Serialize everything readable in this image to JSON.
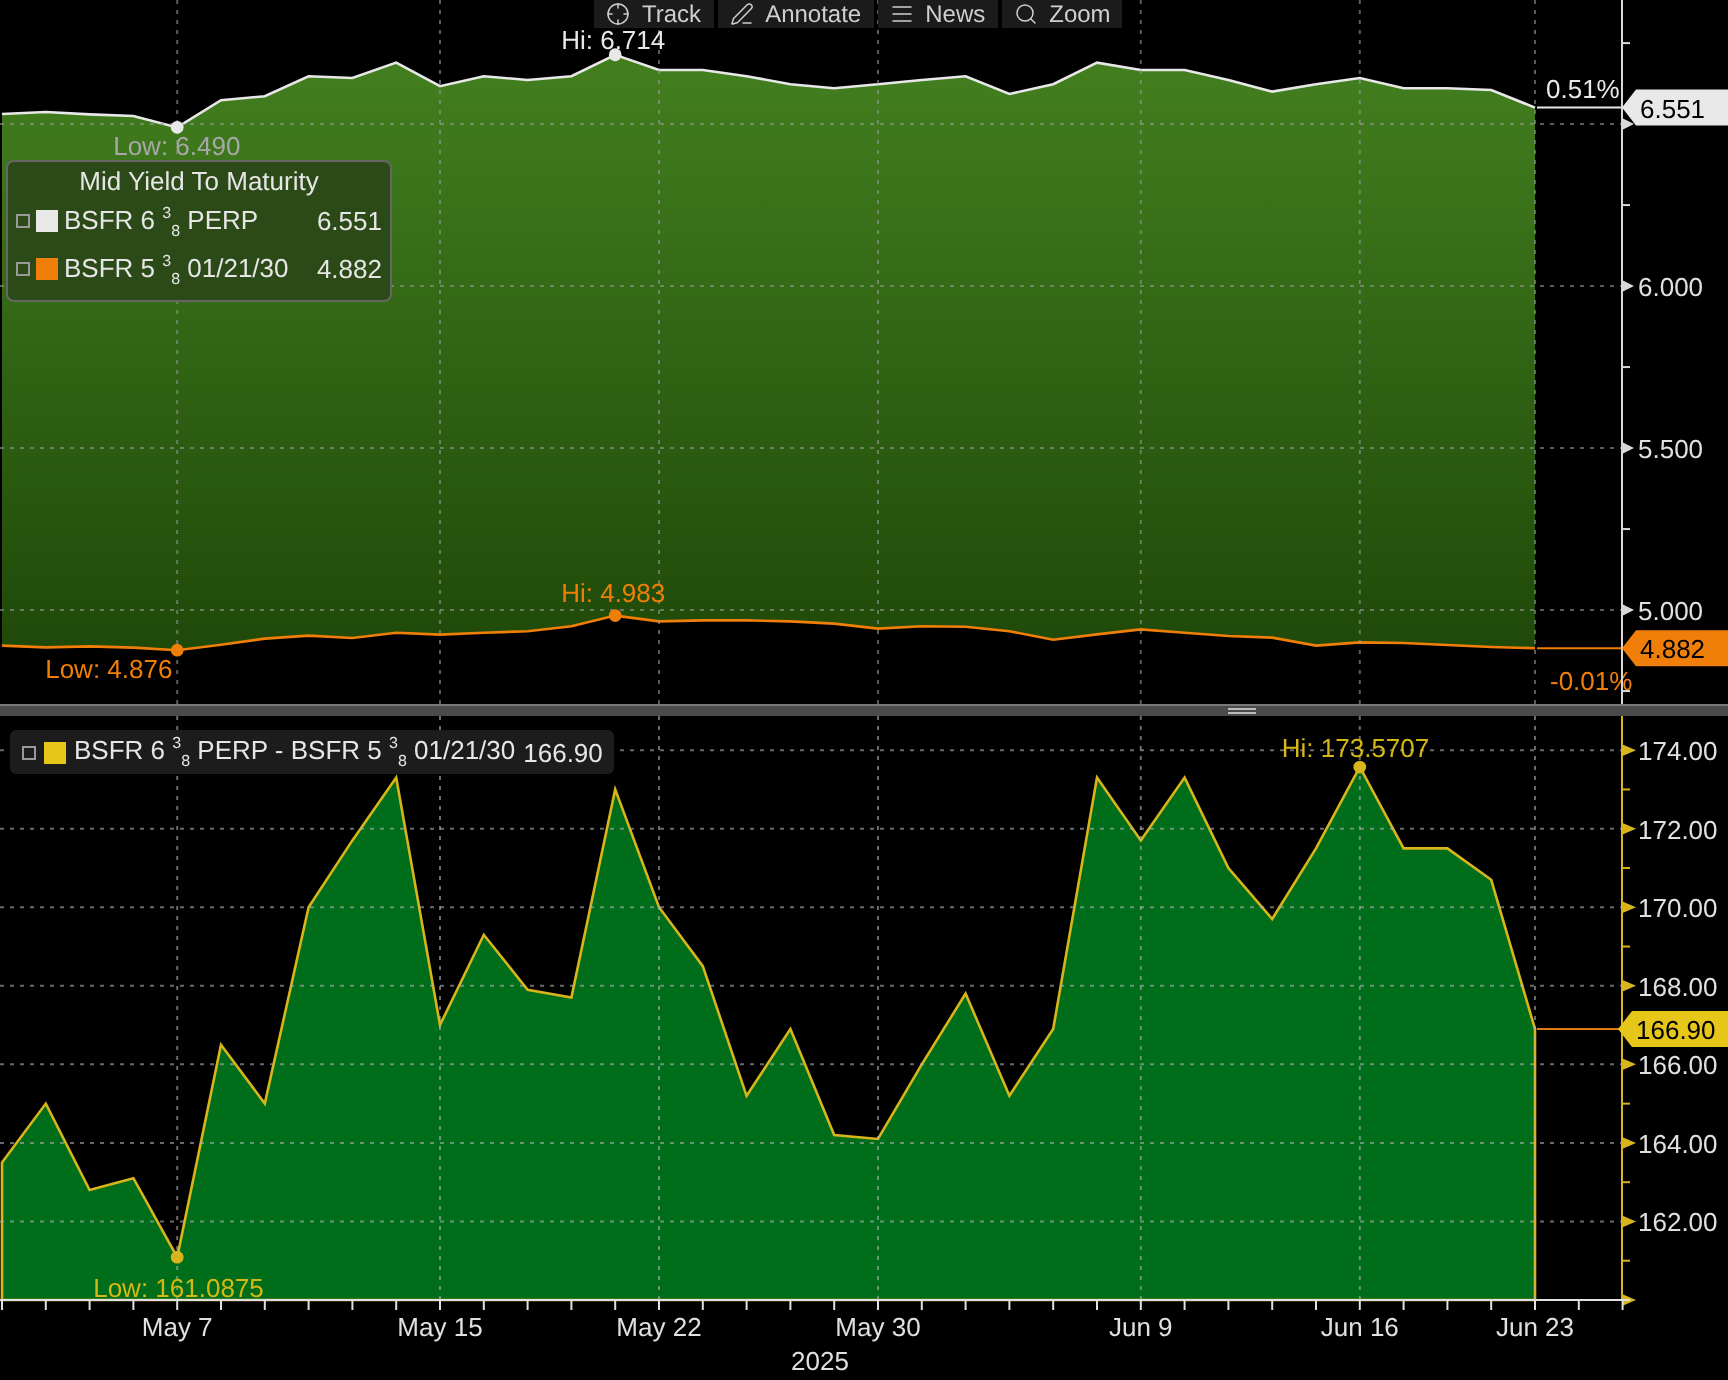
{
  "toolbar": [
    {
      "label": "Track"
    },
    {
      "label": "Annotate"
    },
    {
      "label": "News"
    },
    {
      "label": "Zoom"
    }
  ],
  "top": {
    "legend": {
      "title": "Mid Yield To Maturity",
      "rows": [
        {
          "name": "BSFR 6 $^{3}$$_{8}$ PERP",
          "value": "6.551"
        },
        {
          "name": "BSFR 5 $^{3}$$_{8}$ 01/21/30",
          "value": "4.882"
        }
      ]
    },
    "chart_data": {
      "type": "line",
      "grid": true,
      "series": [
        {
          "color": "#e8e8e8",
          "values": [
            6.531,
            6.537,
            6.53,
            6.525,
            6.49,
            6.574,
            6.586,
            6.648,
            6.642,
            6.69,
            6.617,
            6.648,
            6.636,
            6.648,
            6.714,
            6.667,
            6.667,
            6.648,
            6.623,
            6.611,
            6.623,
            6.636,
            6.648,
            6.593,
            6.623,
            6.69,
            6.667,
            6.667,
            6.636,
            6.6,
            6.623,
            6.642,
            6.611,
            6.611,
            6.605,
            6.551
          ]
        },
        {
          "color": "#f07f09",
          "values": [
            4.89,
            4.885,
            4.888,
            4.884,
            4.876,
            4.893,
            4.912,
            4.921,
            4.914,
            4.93,
            4.924,
            4.93,
            4.935,
            4.95,
            4.983,
            4.965,
            4.968,
            4.968,
            4.965,
            4.958,
            4.943,
            4.95,
            4.948,
            4.935,
            4.908,
            4.925,
            4.94,
            4.93,
            4.92,
            4.915,
            4.89,
            4.9,
            4.898,
            4.892,
            4.886,
            4.882
          ]
        }
      ],
      "ylim": [
        4.71,
        6.883
      ],
      "yticks": [
        {
          "value": 6.0,
          "label": "6.000"
        },
        {
          "value": 5.5,
          "label": "5.500"
        },
        {
          "value": 5.0,
          "label": "5.000"
        }
      ],
      "annotations": [
        {
          "text": "Hi: 6.714",
          "y": 6.714
        },
        {
          "text": "Low: 6.490",
          "y": 6.49
        },
        {
          "text": "Hi: 4.983",
          "y": 4.983
        },
        {
          "text": "Low: 4.876",
          "y": 4.876
        }
      ]
    },
    "changes": [
      {
        "text": "0.51%"
      },
      {
        "text": "-0.01%"
      }
    ],
    "tags": [
      {
        "text": "6.551"
      },
      {
        "text": "4.882"
      }
    ]
  },
  "bottom": {
    "legend": {
      "name": "BSFR 6 $^{3}$$_{8}$ PERP - BSFR 5 $^{3}$$_{8}$ 01/21/30",
      "value": "166.90"
    },
    "chart_data": {
      "type": "area",
      "grid": true,
      "xlabel": "2025",
      "categories": [
        null,
        null,
        null,
        null,
        "May 7",
        null,
        null,
        null,
        null,
        null,
        "May 15",
        null,
        null,
        null,
        null,
        "May 22",
        null,
        null,
        null,
        null,
        "May 30",
        null,
        null,
        null,
        null,
        null,
        "Jun 9",
        null,
        null,
        null,
        null,
        "Jun 16",
        null,
        null,
        null,
        "Jun 23"
      ],
      "series": [
        {
          "color": "#d8b51a",
          "values": [
            163.5,
            165.0,
            162.8,
            163.1,
            161.09,
            166.5,
            165.0,
            170.0,
            171.7,
            173.3,
            167.0,
            169.3,
            167.9,
            167.7,
            173.0,
            170.0,
            168.5,
            165.2,
            166.9,
            164.2,
            164.1,
            166.0,
            167.8,
            165.2,
            166.9,
            173.3,
            171.7,
            173.3,
            171.0,
            169.7,
            171.5,
            173.57,
            171.5,
            171.5,
            170.7,
            166.9
          ]
        }
      ],
      "ylim": [
        160.0,
        174.87
      ],
      "yticks": [
        {
          "value": 174,
          "label": "174.00"
        },
        {
          "value": 172,
          "label": "172.00"
        },
        {
          "value": 170,
          "label": "170.00"
        },
        {
          "value": 168,
          "label": "168.00"
        },
        {
          "value": 166,
          "label": "166.00"
        },
        {
          "value": 164,
          "label": "164.00"
        },
        {
          "value": 162,
          "label": "162.00"
        }
      ],
      "annotations": [
        {
          "text": "Hi: 173.5707",
          "y": 173.57
        },
        {
          "text": "Low: 161.0875",
          "y": 161.09
        }
      ]
    },
    "tag": {
      "text": "166.90"
    }
  }
}
